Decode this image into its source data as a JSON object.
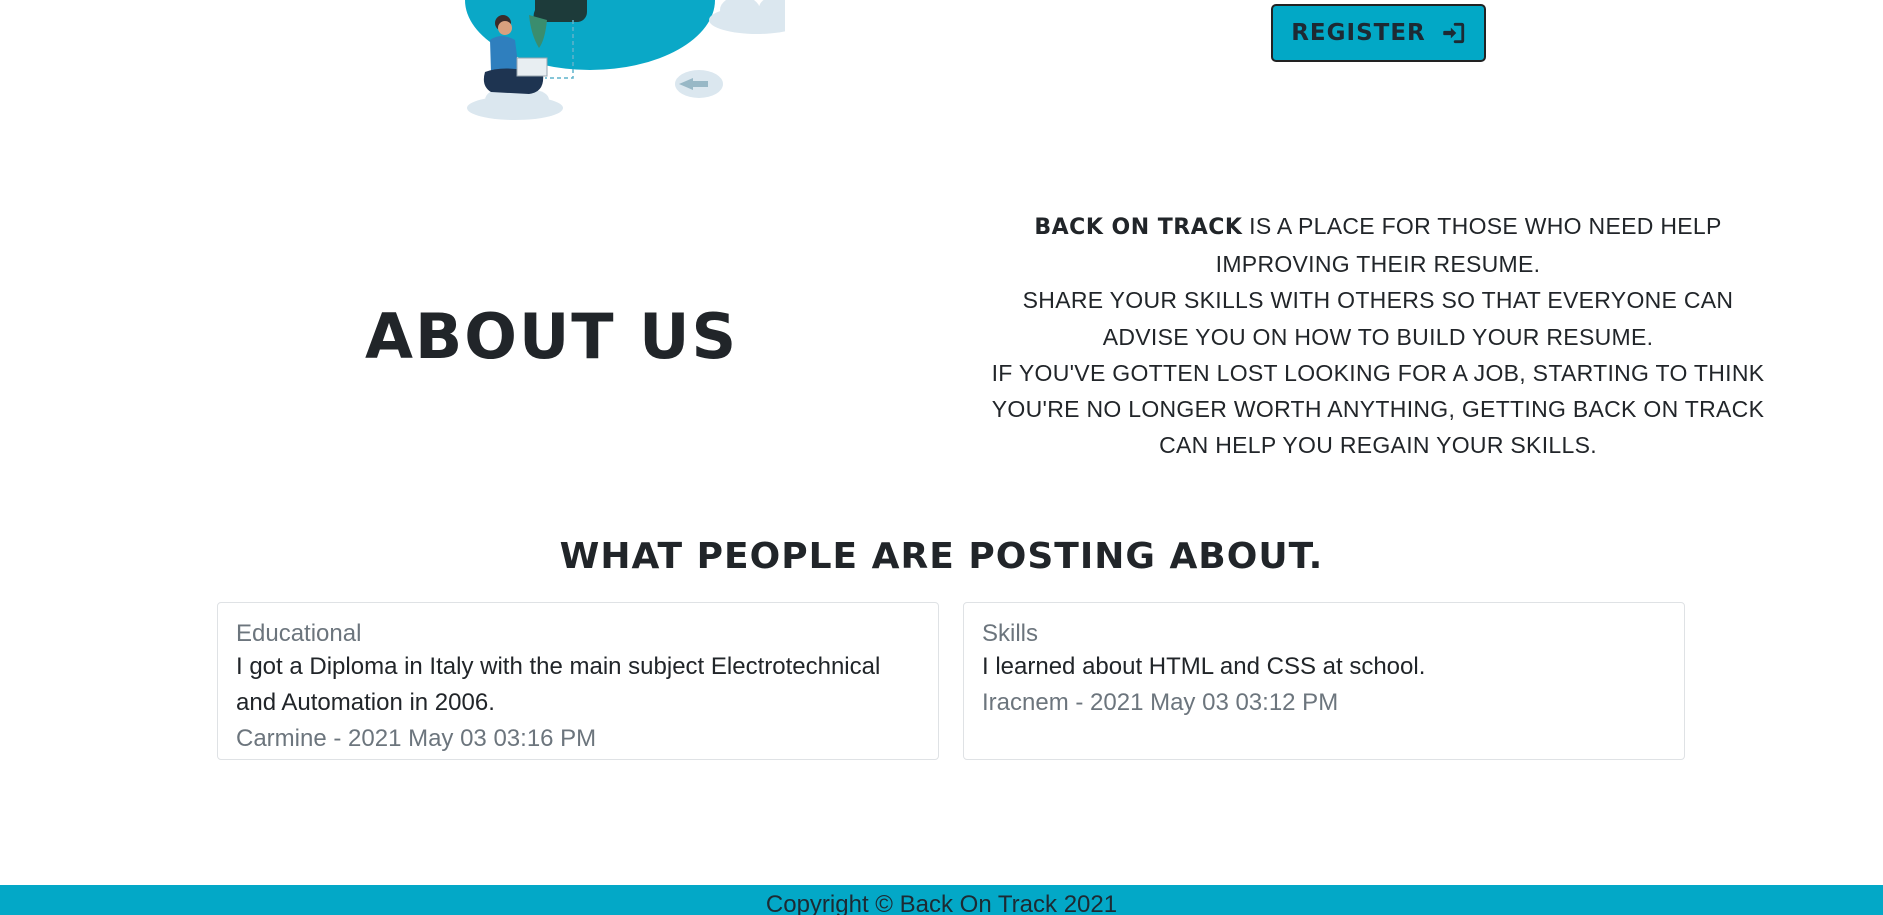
{
  "header": {
    "register_label": "REGISTER",
    "register_icon": "sign-in-icon"
  },
  "about": {
    "title": "ABOUT US",
    "brand": "BACK ON TRACK",
    "line1_rest": " IS A PLACE FOR THOSE WHO NEED HELP IMPROVING THEIR RESUME.",
    "line2": "SHARE YOUR SKILLS WITH OTHERS SO THAT EVERYONE CAN ADVISE YOU ON HOW TO BUILD YOUR RESUME.",
    "line3": "IF YOU'VE GOTTEN LOST LOOKING FOR A JOB, STARTING TO THINK YOU'RE NO LONGER WORTH ANYTHING, GETTING BACK ON TRACK CAN HELP YOU REGAIN YOUR SKILLS."
  },
  "posts": {
    "heading": "WHAT PEOPLE ARE POSTING ABOUT.",
    "items": [
      {
        "category": "Educational",
        "text": "I got a Diploma in Italy with the main subject Electrotechnical and Automation in 2006.",
        "meta": "Carmine - 2021 May 03 03:16 PM"
      },
      {
        "category": "Skills",
        "text": "I learned about HTML and CSS at school.",
        "meta": "Iracnem - 2021 May 03 03:12 PM"
      }
    ]
  },
  "footer": {
    "copyright": "Copyright © Back On Track 2021"
  },
  "colors": {
    "accent": "#02a8c6",
    "footer": "#03a8c7",
    "text": "#212529",
    "muted": "#6c757d"
  }
}
